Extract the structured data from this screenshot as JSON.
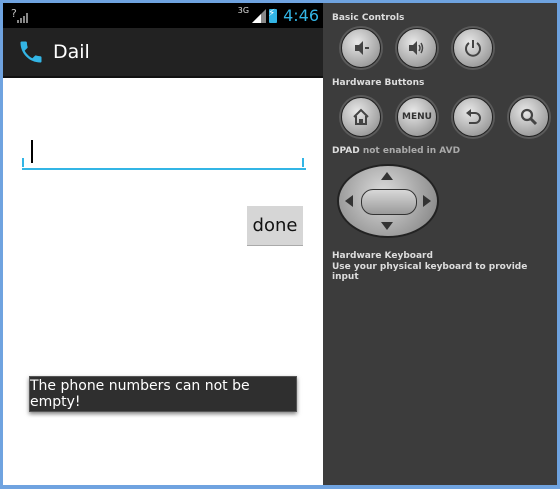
{
  "status_bar": {
    "network_left": "?",
    "network_type": "3G",
    "clock": "4:46"
  },
  "action_bar": {
    "title": "Dail",
    "icon": "phone-icon"
  },
  "form": {
    "phone_input_value": "",
    "done_label": "done"
  },
  "toast": {
    "message": "The phone numbers can not be empty!"
  },
  "emulator": {
    "basic_controls_label": "Basic Controls",
    "hardware_buttons_label": "Hardware Buttons",
    "menu_label": "MENU",
    "dpad_label": "DPAD",
    "dpad_note": "not enabled in AVD",
    "keyboard_title": "Hardware Keyboard",
    "keyboard_desc": "Use your physical keyboard to provide input",
    "basic_buttons": [
      "volume-down-icon",
      "volume-up-icon",
      "power-icon"
    ],
    "hardware_buttons": [
      "home-icon",
      "menu",
      "back-icon",
      "search-icon"
    ]
  },
  "colors": {
    "accent": "#33b5e5",
    "window_border": "#6fa3e0",
    "controls_bg": "#3c3c3c"
  }
}
